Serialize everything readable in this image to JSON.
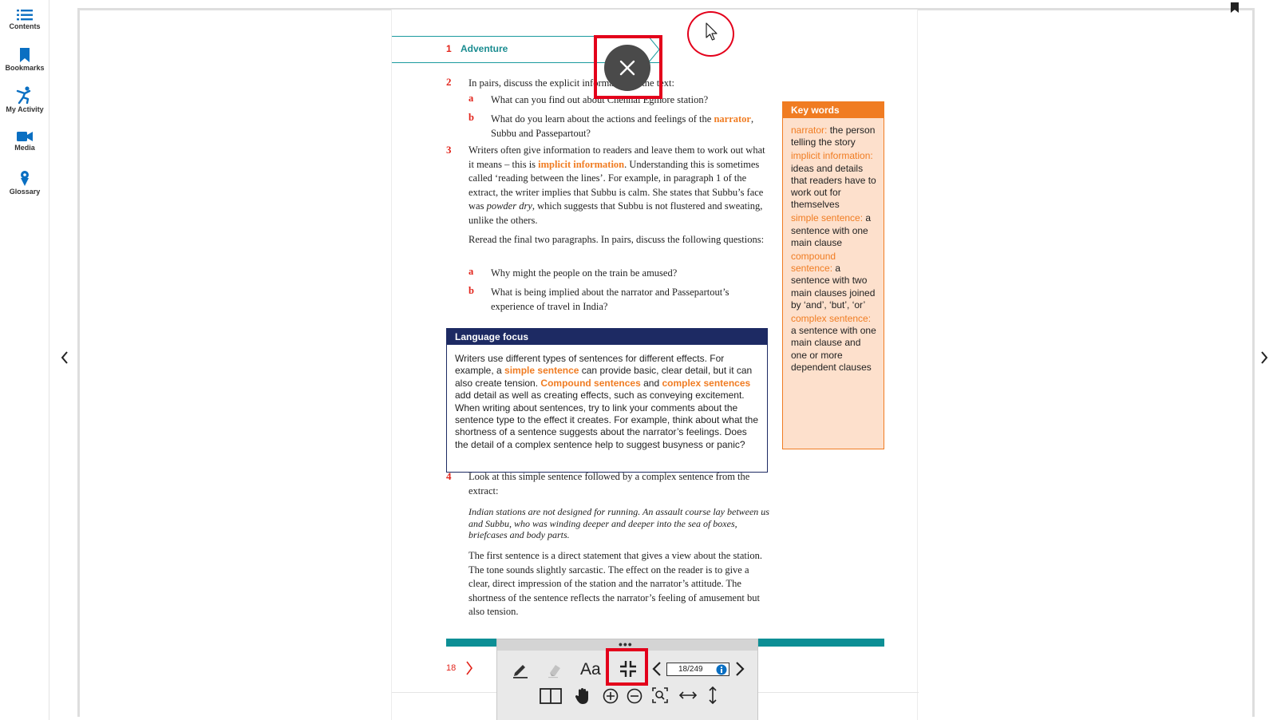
{
  "sidebar": {
    "items": [
      {
        "label": "Contents",
        "icon": "list-icon"
      },
      {
        "label": "Bookmarks",
        "icon": "bookmark-icon"
      },
      {
        "label": "My Activity",
        "icon": "activity-icon"
      },
      {
        "label": "Media",
        "icon": "video-camera-icon"
      },
      {
        "label": "Glossary",
        "icon": "glossary-icon"
      }
    ]
  },
  "colors": {
    "accent_blue": "#0a6fc2",
    "red": "#e2231a",
    "teal": "#1a8c90",
    "orange": "#f07c22",
    "navy": "#1d2a63",
    "key_words_bg": "#fde0cc",
    "highlight_red": "#e3001b"
  },
  "page": {
    "chapter_number": "1",
    "chapter_title": "Adventure",
    "q2": {
      "number": "2",
      "text": "In pairs, discuss the explicit information in the text:",
      "a_letter": "a",
      "a_text": "What can you find out about Chennai Egmore station?",
      "b_letter": "b",
      "b_text_1": "What do you learn about the actions and feelings of the",
      "b_keyword": "narrator",
      "b_text_2": ", Subbu and Passepartout?"
    },
    "q3": {
      "number": "3",
      "p1_a": "Writers often give information to readers and leave them to work out what it means – this is ",
      "p1_keyword": "implicit information",
      "p1_b": ". Understanding this is sometimes called ‘reading between the lines’. For example, in paragraph 1 of the extract, the writer implies that Subbu is calm. She states that Subbu’s face was ",
      "p1_italic": "powder dry",
      "p1_c": ", which suggests that Subbu is not flustered and sweating, unlike the others.",
      "p2": "Reread the final two paragraphs. In pairs, discuss the following questions:",
      "a_letter": "a",
      "a_text": "Why might the people on the train be amused?",
      "b_letter": "b",
      "b_text": "What is being implied about the narrator and Passepartout’s experience of travel in India?"
    },
    "language_focus": {
      "title": "Language focus",
      "t1": "Writers use different types of sentences for different effects. For example, a ",
      "k1": "simple sentence",
      "t2": " can provide basic, clear detail, but it can also create tension. ",
      "k2": "Compound sentences",
      "t3": " and ",
      "k3": "complex sentences",
      "t4": " add detail as well as creating effects, such as conveying excitement. When writing about sentences, try to link your comments about the sentence type to the effect it creates. For example, think about what the shortness of a sentence suggests about the narrator’s feelings. Does the detail of a complex sentence help to suggest busyness or panic?"
    },
    "key_words": {
      "title": "Key words",
      "entries": [
        {
          "term": "narrator:",
          "definition": " the person telling the story"
        },
        {
          "term": "implicit information:",
          "definition": " ideas and details that readers have to work out for themselves"
        },
        {
          "term": "simple sentence:",
          "definition": " a sentence with one main clause"
        },
        {
          "term": "compound sentence:",
          "definition": " a sentence with two main clauses joined by ‘and’, ‘but’, ‘or’"
        },
        {
          "term": "complex sentence:",
          "definition": " a sentence with one main clause and one or more dependent clauses"
        }
      ]
    },
    "q4": {
      "number": "4",
      "text": "Look at this simple sentence followed by a complex sentence from the extract:",
      "quote": "Indian stations are not designed for running. An assault course lay between us and Subbu, who was winding deeper and deeper into the sea of boxes, briefcases and body parts.",
      "analysis": "The first sentence is a direct statement that gives a view about the station. The tone sounds slightly sarcastic. The effect on the reader is to give a clear, direct impression of the station and the narrator’s attitude. The shortness of the sentence reflects the narrator’s feeling of amusement but also tension."
    },
    "page_number": "18"
  },
  "toolbar": {
    "handle": "•••",
    "font_size_label": "Aa",
    "page_indicator": "18/249"
  }
}
